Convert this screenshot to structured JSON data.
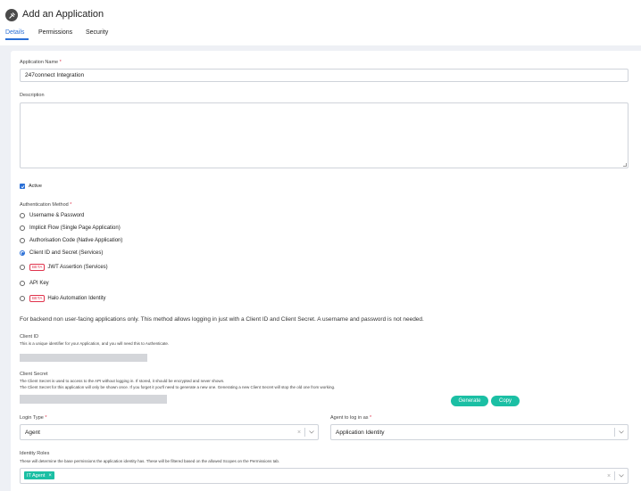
{
  "header": {
    "title": "Add an Application",
    "tabs": [
      {
        "label": "Details",
        "active": true
      },
      {
        "label": "Permissions",
        "active": false
      },
      {
        "label": "Security",
        "active": false
      }
    ]
  },
  "form": {
    "app_name_label": "Application Name",
    "required_mark": "*",
    "app_name_value": "247connect Integration",
    "description_label": "Description",
    "description_value": "",
    "active_label": "Active",
    "active_checked": true,
    "auth_method_label": "Authentication Method",
    "auth_methods": [
      {
        "label": "Username & Password",
        "selected": false,
        "beta": false
      },
      {
        "label": "Implicit Flow (Single Page Application)",
        "selected": false,
        "beta": false
      },
      {
        "label": "Authorisation Code (Native Application)",
        "selected": false,
        "beta": false
      },
      {
        "label": "Client ID and Secret (Services)",
        "selected": true,
        "beta": false
      },
      {
        "label": "JWT Assertion (Services)",
        "selected": false,
        "beta": true
      },
      {
        "label": "API Key",
        "selected": false,
        "beta": false
      },
      {
        "label": "Halo Automation Identity",
        "selected": false,
        "beta": true
      }
    ],
    "beta_label": "BETA",
    "auth_note": "For backend non user-facing applications only. This method allows logging in just with a Client ID and Client Secret. A username and password is not needed.",
    "client_id_label": "Client ID",
    "client_id_help": "This is a unique identifier for your Application, and you will need this to Authenticate.",
    "client_secret_label": "Client Secret",
    "client_secret_help1": "The Client Secret is used to access to the API without logging in. If stored, it should be encrypted and never shown.",
    "client_secret_help2": "The Client Secret for this application will only be shown once. If you forget it you'll need to generate a new one. Generating a new Client Secret will stop the old one from working.",
    "generate_label": "Generate",
    "copy_label": "Copy",
    "login_type_label": "Login Type",
    "login_type_value": "Agent",
    "agent_login_label": "Agent to log in as",
    "agent_login_value": "Application Identity",
    "identity_roles_label": "Identity Roles",
    "identity_roles_help": "These will determine the base permissions the application identity has. These will be filtered based on the allowed Scopes on the Permissions tab.",
    "identity_roles": [
      "IT Agent"
    ]
  },
  "colors": {
    "accent": "#2a6fd6",
    "teal": "#1bbfa4",
    "required": "#e0334c"
  }
}
